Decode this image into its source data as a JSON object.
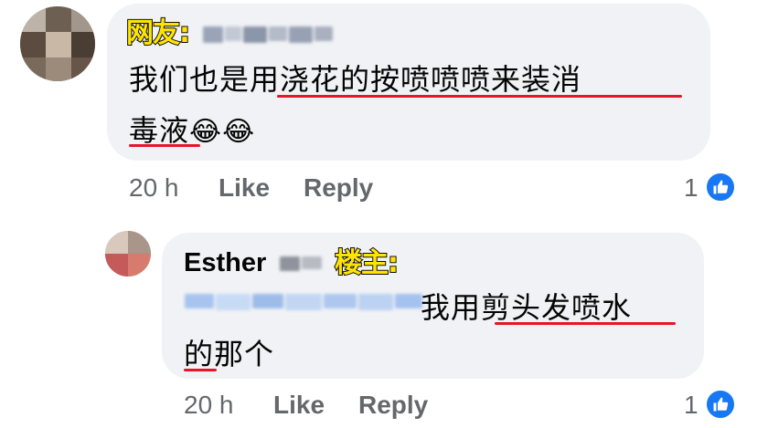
{
  "colors": {
    "bubble": "#f0f2f5",
    "meta": "#65676b",
    "underline": "#e8142a",
    "tag_fill": "#ffe400",
    "like_blue": "#1877f2"
  },
  "comment1": {
    "tag": "网友:",
    "line1_a": "我们也是",
    "line1_b": "用浇花的按喷喷喷来装消",
    "line2_a": "毒液",
    "emojis": "😂😂",
    "time": "20 h",
    "like": "Like",
    "reply": "Reply",
    "reaction_count": "1",
    "reaction_icon": "thumbs-up-icon"
  },
  "comment2": {
    "name": "Esther",
    "tag": "楼主:",
    "line1_b": "我用",
    "line1_c": "剪头发喷水",
    "line2_a": "的",
    "line2_b": "那个",
    "time": "20 h",
    "like": "Like",
    "reply": "Reply",
    "reaction_count": "1",
    "reaction_icon": "thumbs-up-icon"
  }
}
